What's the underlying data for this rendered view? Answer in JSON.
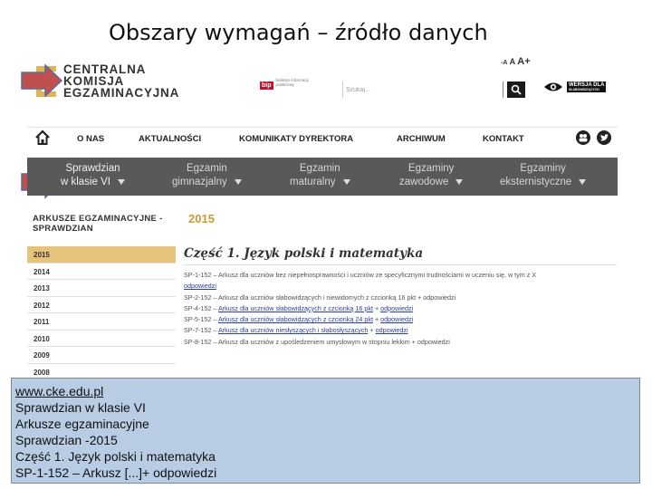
{
  "slide": {
    "title": "Obszary wymagań – źródło danych"
  },
  "header": {
    "logo_lines": [
      "CENTRALNA",
      "KOMISJA",
      "EGZAMINACYJNA"
    ],
    "bip_badge": "bip",
    "bip_text": "biuletyn informacji publicznej",
    "search_placeholder": "Szukaj...",
    "font_size_small": "-A",
    "font_size_medium": "A",
    "font_size_large": "A+",
    "contrast_line1": "WERSJA DLA",
    "contrast_line2": "SŁABOWIDZĄCYCH"
  },
  "main_nav": {
    "items": [
      "O NAS",
      "AKTUALNOŚCI",
      "KOMUNIKATY DYREKTORA",
      "ARCHIWUM",
      "KONTAKT"
    ]
  },
  "sub_nav": {
    "items": [
      {
        "line1": "Sprawdzian",
        "line2": "w klasie VI"
      },
      {
        "line1": "Egzamin",
        "line2": "gimnazjalny"
      },
      {
        "line1": "Egzamin",
        "line2": "maturalny"
      },
      {
        "line1": "Egzaminy",
        "line2": "zawodowe"
      },
      {
        "line1": "Egzaminy",
        "line2": "eksternistyczne"
      }
    ]
  },
  "section": {
    "title_line1": "ARKUSZE EGZAMINACYJNE -",
    "title_line2": "SPRAWDZIAN",
    "year": "2015"
  },
  "sidebar": {
    "years": [
      "2015",
      "2014",
      "2013",
      "2012",
      "2011",
      "2010",
      "2009",
      "2008"
    ]
  },
  "content": {
    "title": "Część 1. Język polski i matematyka",
    "docs": [
      {
        "code": "SP-1-152",
        "desc": " – Arkusz dla uczniów bez niepełnosprawności i uczniów ze specyficznymi trudnościami w uczeniu się, w tym z X",
        "link": "",
        "link2": ""
      },
      {
        "code": "",
        "desc": "",
        "link": "odpowiedzi",
        "link2": ""
      },
      {
        "code": "SP-2-152",
        "desc": " – Arkusz dla uczniów słabowidzących i niewidomych z czcionką 16 pkt + odpowiedzi",
        "link": "",
        "link2": ""
      },
      {
        "code": "SP-4-152",
        "desc": " – ",
        "link": "Arkusz dla uczniów słabowidzących z czcionką 16 pkt",
        "link2": "odpowiedzi"
      },
      {
        "code": "SP-5-152",
        "desc": " – ",
        "link": "Arkusz dla uczniów słabowidzących z czcionką 24 pkt",
        "link2": "odpowiedzi"
      },
      {
        "code": "SP-7-152",
        "desc": " – ",
        "link": "Arkusz dla uczniów niesłyszących i słabosłyszących",
        "link2": "odpowiedzi"
      },
      {
        "code": "SP-8-152",
        "desc": " – Arkusz dla uczniów z upośledzeniem umysłowym w stopniu lekkim + odpowiedzi",
        "link": "",
        "link2": ""
      }
    ]
  },
  "callout": {
    "lines": [
      "www.cke.edu.pl",
      "Sprawdzian w klasie VI",
      "Arkusze egzaminacyjne",
      "Sprawdzian -2015",
      "Część 1. Język polski i matematyka",
      "SP-1-152 – Arkusz [...]+ odpowiedzi"
    ]
  },
  "colors": {
    "arrow_fill": "#c0504d",
    "arrow_stroke": "#4f6fa0",
    "callout_bg": "#b8cce4",
    "sub_nav_bg": "#595959",
    "active_year_bg": "#e6c27a",
    "year_text": "#c79b36"
  }
}
